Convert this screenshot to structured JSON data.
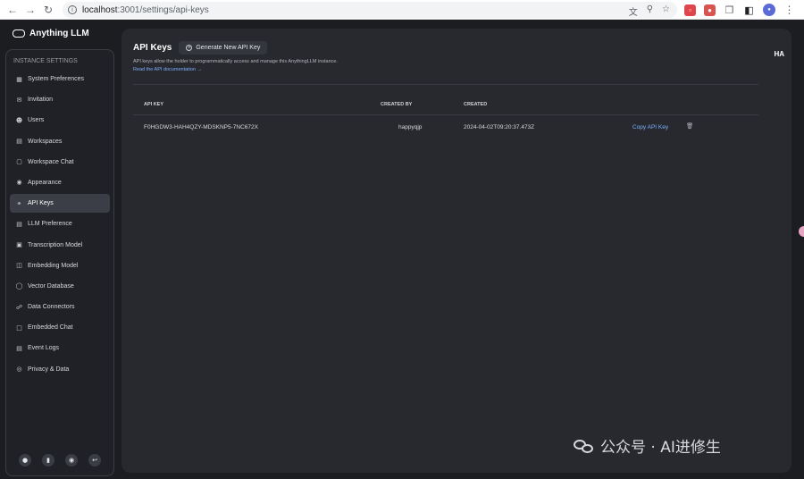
{
  "browser": {
    "url_host": "localhost",
    "url_rest": ":3001/settings/api-keys"
  },
  "app": {
    "logo_text": "Anything LLM",
    "user_initials": "HA"
  },
  "sidebar": {
    "title": "INSTANCE SETTINGS",
    "items": [
      {
        "label": "System Preferences",
        "icon": "sliders-icon"
      },
      {
        "label": "Invitation",
        "icon": "envelope-icon"
      },
      {
        "label": "Users",
        "icon": "users-icon"
      },
      {
        "label": "Workspaces",
        "icon": "book-icon"
      },
      {
        "label": "Workspace Chat",
        "icon": "chat-icon"
      },
      {
        "label": "Appearance",
        "icon": "eye-icon"
      },
      {
        "label": "API Keys",
        "icon": "key-icon",
        "active": true
      },
      {
        "label": "LLM Preference",
        "icon": "chat-text-icon"
      },
      {
        "label": "Transcription Model",
        "icon": "closed-caption-icon"
      },
      {
        "label": "Embedding Model",
        "icon": "file-icon"
      },
      {
        "label": "Vector Database",
        "icon": "database-icon"
      },
      {
        "label": "Data Connectors",
        "icon": "plug-icon"
      },
      {
        "label": "Embedded Chat",
        "icon": "code-icon"
      },
      {
        "label": "Event Logs",
        "icon": "list-icon"
      },
      {
        "label": "Privacy & Data",
        "icon": "lock-icon"
      }
    ]
  },
  "main": {
    "title": "API Keys",
    "generate_button": "Generate New API Key",
    "description": "API keys allow the holder to programmatically access and manage this AnythingLLM instance.",
    "docs_link": "Read the API documentation →",
    "table": {
      "headers": [
        "API KEY",
        "CREATED BY",
        "CREATED"
      ],
      "rows": [
        {
          "key": "F0HGDW3-HAH4QZY-MDSKNP5-7NC672X",
          "created_by": "happyqjp",
          "created": "2024-04-02T09:20:37.473Z",
          "copy_label": "Copy API Key"
        }
      ]
    }
  },
  "watermark": {
    "text": "公众号 · AI进修生"
  },
  "colors": {
    "link": "#7db0ff",
    "active_item": "#3b3e46",
    "background": "#1b1d21",
    "panel": "#27292f"
  }
}
